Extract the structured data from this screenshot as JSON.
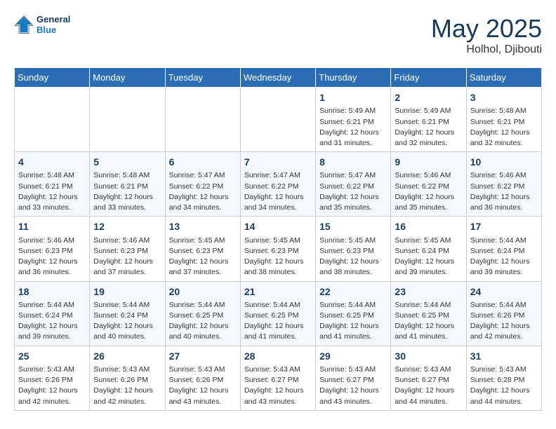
{
  "header": {
    "logo_line1": "General",
    "logo_line2": "Blue",
    "month_year": "May 2025",
    "location": "Holhol, Djibouti"
  },
  "days_of_week": [
    "Sunday",
    "Monday",
    "Tuesday",
    "Wednesday",
    "Thursday",
    "Friday",
    "Saturday"
  ],
  "weeks": [
    [
      {
        "day": "",
        "info": ""
      },
      {
        "day": "",
        "info": ""
      },
      {
        "day": "",
        "info": ""
      },
      {
        "day": "",
        "info": ""
      },
      {
        "day": "1",
        "info": "Sunrise: 5:49 AM\nSunset: 6:21 PM\nDaylight: 12 hours\nand 31 minutes."
      },
      {
        "day": "2",
        "info": "Sunrise: 5:49 AM\nSunset: 6:21 PM\nDaylight: 12 hours\nand 32 minutes."
      },
      {
        "day": "3",
        "info": "Sunrise: 5:48 AM\nSunset: 6:21 PM\nDaylight: 12 hours\nand 32 minutes."
      }
    ],
    [
      {
        "day": "4",
        "info": "Sunrise: 5:48 AM\nSunset: 6:21 PM\nDaylight: 12 hours\nand 33 minutes."
      },
      {
        "day": "5",
        "info": "Sunrise: 5:48 AM\nSunset: 6:21 PM\nDaylight: 12 hours\nand 33 minutes."
      },
      {
        "day": "6",
        "info": "Sunrise: 5:47 AM\nSunset: 6:22 PM\nDaylight: 12 hours\nand 34 minutes."
      },
      {
        "day": "7",
        "info": "Sunrise: 5:47 AM\nSunset: 6:22 PM\nDaylight: 12 hours\nand 34 minutes."
      },
      {
        "day": "8",
        "info": "Sunrise: 5:47 AM\nSunset: 6:22 PM\nDaylight: 12 hours\nand 35 minutes."
      },
      {
        "day": "9",
        "info": "Sunrise: 5:46 AM\nSunset: 6:22 PM\nDaylight: 12 hours\nand 35 minutes."
      },
      {
        "day": "10",
        "info": "Sunrise: 5:46 AM\nSunset: 6:22 PM\nDaylight: 12 hours\nand 36 minutes."
      }
    ],
    [
      {
        "day": "11",
        "info": "Sunrise: 5:46 AM\nSunset: 6:23 PM\nDaylight: 12 hours\nand 36 minutes."
      },
      {
        "day": "12",
        "info": "Sunrise: 5:46 AM\nSunset: 6:23 PM\nDaylight: 12 hours\nand 37 minutes."
      },
      {
        "day": "13",
        "info": "Sunrise: 5:45 AM\nSunset: 6:23 PM\nDaylight: 12 hours\nand 37 minutes."
      },
      {
        "day": "14",
        "info": "Sunrise: 5:45 AM\nSunset: 6:23 PM\nDaylight: 12 hours\nand 38 minutes."
      },
      {
        "day": "15",
        "info": "Sunrise: 5:45 AM\nSunset: 6:23 PM\nDaylight: 12 hours\nand 38 minutes."
      },
      {
        "day": "16",
        "info": "Sunrise: 5:45 AM\nSunset: 6:24 PM\nDaylight: 12 hours\nand 39 minutes."
      },
      {
        "day": "17",
        "info": "Sunrise: 5:44 AM\nSunset: 6:24 PM\nDaylight: 12 hours\nand 39 minutes."
      }
    ],
    [
      {
        "day": "18",
        "info": "Sunrise: 5:44 AM\nSunset: 6:24 PM\nDaylight: 12 hours\nand 39 minutes."
      },
      {
        "day": "19",
        "info": "Sunrise: 5:44 AM\nSunset: 6:24 PM\nDaylight: 12 hours\nand 40 minutes."
      },
      {
        "day": "20",
        "info": "Sunrise: 5:44 AM\nSunset: 6:25 PM\nDaylight: 12 hours\nand 40 minutes."
      },
      {
        "day": "21",
        "info": "Sunrise: 5:44 AM\nSunset: 6:25 PM\nDaylight: 12 hours\nand 41 minutes."
      },
      {
        "day": "22",
        "info": "Sunrise: 5:44 AM\nSunset: 6:25 PM\nDaylight: 12 hours\nand 41 minutes."
      },
      {
        "day": "23",
        "info": "Sunrise: 5:44 AM\nSunset: 6:25 PM\nDaylight: 12 hours\nand 41 minutes."
      },
      {
        "day": "24",
        "info": "Sunrise: 5:44 AM\nSunset: 6:26 PM\nDaylight: 12 hours\nand 42 minutes."
      }
    ],
    [
      {
        "day": "25",
        "info": "Sunrise: 5:43 AM\nSunset: 6:26 PM\nDaylight: 12 hours\nand 42 minutes."
      },
      {
        "day": "26",
        "info": "Sunrise: 5:43 AM\nSunset: 6:26 PM\nDaylight: 12 hours\nand 42 minutes."
      },
      {
        "day": "27",
        "info": "Sunrise: 5:43 AM\nSunset: 6:26 PM\nDaylight: 12 hours\nand 43 minutes."
      },
      {
        "day": "28",
        "info": "Sunrise: 5:43 AM\nSunset: 6:27 PM\nDaylight: 12 hours\nand 43 minutes."
      },
      {
        "day": "29",
        "info": "Sunrise: 5:43 AM\nSunset: 6:27 PM\nDaylight: 12 hours\nand 43 minutes."
      },
      {
        "day": "30",
        "info": "Sunrise: 5:43 AM\nSunset: 6:27 PM\nDaylight: 12 hours\nand 44 minutes."
      },
      {
        "day": "31",
        "info": "Sunrise: 5:43 AM\nSunset: 6:28 PM\nDaylight: 12 hours\nand 44 minutes."
      }
    ]
  ]
}
